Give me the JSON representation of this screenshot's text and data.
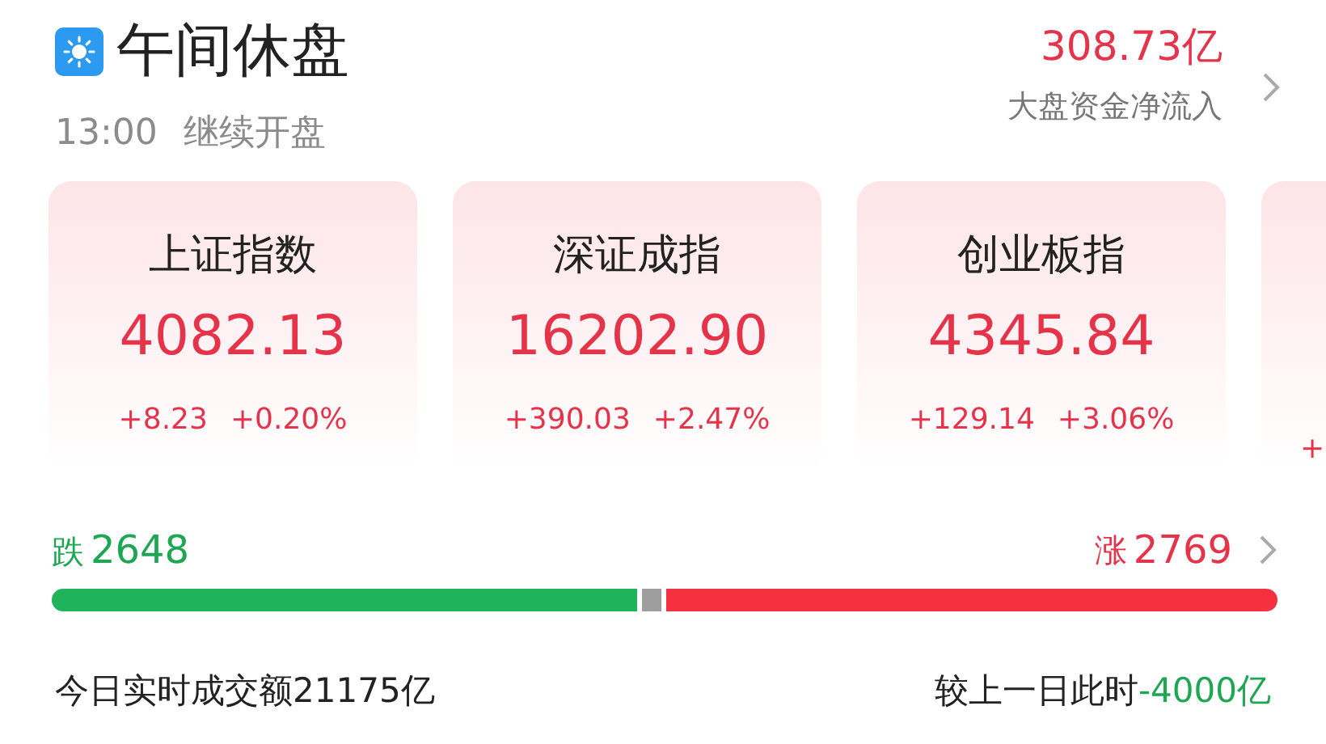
{
  "header": {
    "title": "午间休盘",
    "time": "13:00",
    "note": "继续开盘",
    "net_inflow": "308.73亿",
    "net_inflow_label": "大盘资金净流入"
  },
  "indices": [
    {
      "name": "上证指数",
      "value": "4082.13",
      "change": "+8.23",
      "percent": "+0.20%",
      "rising": true
    },
    {
      "name": "深证成指",
      "value": "16202.90",
      "change": "+390.03",
      "percent": "+2.47%",
      "rising": true
    },
    {
      "name": "创业板指",
      "value": "4345.84",
      "change": "+129.14",
      "percent": "+3.06%",
      "rising": true
    },
    {
      "change": "+",
      "rising": true
    }
  ],
  "breadth": {
    "down_label": "跌",
    "down_count": "2648",
    "up_label": "涨",
    "up_count": "2769"
  },
  "turnover": {
    "text": "今日实时成交额21175亿",
    "compare_label": "较上一日此时",
    "compare_value": "-4000亿",
    "compare_rising": false
  }
}
